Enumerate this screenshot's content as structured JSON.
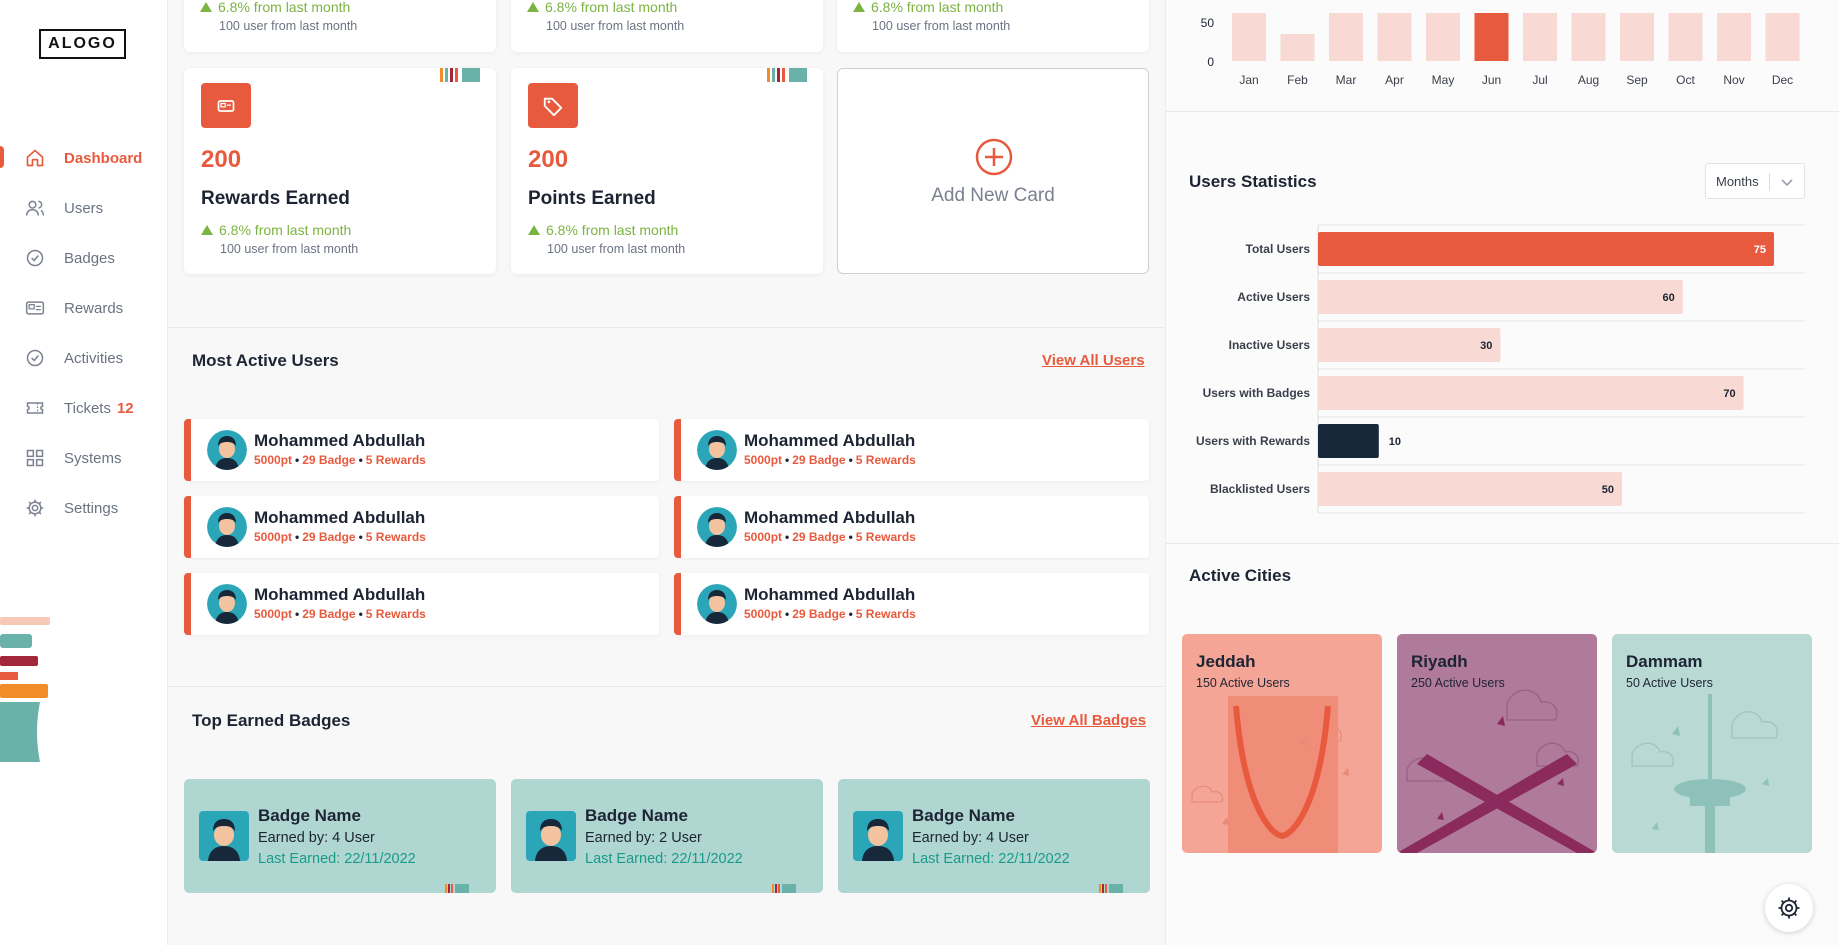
{
  "brand": {
    "logo": "ALOGO",
    "accent": "#e85a3d",
    "navy": "#16283a",
    "teal": "#b0d6d2"
  },
  "sidebar": {
    "items": [
      {
        "label": "Dashboard",
        "icon": "home-icon",
        "active": true
      },
      {
        "label": "Users",
        "icon": "users-icon"
      },
      {
        "label": "Badges",
        "icon": "badge-check-icon"
      },
      {
        "label": "Rewards",
        "icon": "reward-card-icon"
      },
      {
        "label": "Activities",
        "icon": "activity-check-icon"
      },
      {
        "label": "Tickets",
        "icon": "ticket-icon",
        "count": "12"
      },
      {
        "label": "Systems",
        "icon": "grid-icon"
      },
      {
        "label": "Settings",
        "icon": "gear-icon"
      }
    ]
  },
  "top_cards": [
    {
      "trend": "6.8% from last month",
      "sub": "100 user from last month"
    },
    {
      "trend": "6.8% from last month",
      "sub": "100 user from last month"
    },
    {
      "trend": "6.8% from last month",
      "sub": "100 user from last month"
    }
  ],
  "stat_cards": [
    {
      "value": "200",
      "title": "Rewards Earned",
      "icon": "reward-card-icon",
      "trend": "6.8% from last month",
      "sub": "100 user from last month"
    },
    {
      "value": "200",
      "title": "Points Earned",
      "icon": "tag-icon",
      "trend": "6.8% from last month",
      "sub": "100 user from last month"
    }
  ],
  "add_card": {
    "label": "Add New Card",
    "icon": "plus-circle-icon"
  },
  "most_active": {
    "title": "Most Active Users",
    "link": "View All Users",
    "users": [
      {
        "name": "Mohammed Abdullah",
        "points": "5000pt",
        "badges": "29 Badge",
        "rewards": "5 Rewards"
      },
      {
        "name": "Mohammed Abdullah",
        "points": "5000pt",
        "badges": "29 Badge",
        "rewards": "5 Rewards"
      },
      {
        "name": "Mohammed Abdullah",
        "points": "5000pt",
        "badges": "29 Badge",
        "rewards": "5 Rewards"
      },
      {
        "name": "Mohammed Abdullah",
        "points": "5000pt",
        "badges": "29 Badge",
        "rewards": "5 Rewards"
      },
      {
        "name": "Mohammed Abdullah",
        "points": "5000pt",
        "badges": "29 Badge",
        "rewards": "5 Rewards"
      },
      {
        "name": "Mohammed Abdullah",
        "points": "5000pt",
        "badges": "29 Badge",
        "rewards": "5 Rewards"
      }
    ],
    "separator": "•"
  },
  "top_badges": {
    "title": "Top Earned Badges",
    "link": "View All Badges",
    "badges": [
      {
        "name": "Badge Name",
        "earned": "Earned by: 4 User",
        "last": "Last Earned: 22/11/2022"
      },
      {
        "name": "Badge Name",
        "earned": "Earned by: 2 User",
        "last": "Last Earned: 22/11/2022"
      },
      {
        "name": "Badge Name",
        "earned": "Earned by: 4 User",
        "last": "Last Earned: 22/11/2022"
      }
    ]
  },
  "users_statistics": {
    "title": "Users Statistics",
    "dropdown_value": "Months"
  },
  "active_cities": {
    "title": "Active Cities",
    "cities": [
      {
        "name": "Jeddah",
        "users": "150 Active Users",
        "bg": "#f4a596"
      },
      {
        "name": "Riyadh",
        "users": "250 Active Users",
        "bg": "#b07a9a"
      },
      {
        "name": "Dammam",
        "users": "50 Active Users",
        "bg": "#b9d9d5"
      }
    ]
  },
  "chart_data": [
    {
      "type": "bar",
      "categories": [
        "Jan",
        "Feb",
        "Mar",
        "Apr",
        "May",
        "Jun",
        "Jul",
        "Aug",
        "Sep",
        "Oct",
        "Nov",
        "Dec"
      ],
      "values": [
        80,
        45,
        80,
        80,
        80,
        80,
        80,
        80,
        80,
        80,
        80,
        80
      ],
      "highlight": "Jun",
      "yticks": [
        "50",
        "0"
      ],
      "ylim": [
        0,
        80
      ],
      "bar_color": "#f9d9d3",
      "highlight_color": "#e85a3d"
    },
    {
      "type": "bar",
      "orientation": "horizontal",
      "categories": [
        "Total Users",
        "Active Users",
        "Inactive Users",
        "Users with Badges",
        "Users with Rewards",
        "Blacklisted Users"
      ],
      "values": [
        75,
        60,
        30,
        70,
        10,
        50
      ],
      "colors": [
        "#e85a3d",
        "#f9d9d3",
        "#f9d9d3",
        "#f9d9d3",
        "#16283a",
        "#f9d9d3"
      ],
      "xlim": [
        0,
        80
      ]
    }
  ]
}
